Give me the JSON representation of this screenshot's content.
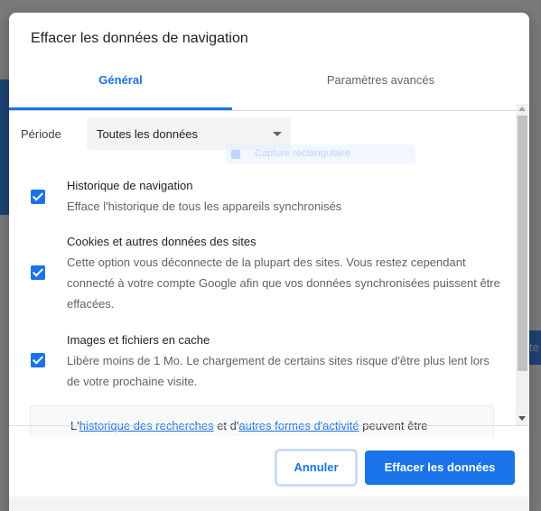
{
  "dialog": {
    "title": "Effacer les données de navigation"
  },
  "tabs": [
    {
      "label": "Général",
      "selected": true
    },
    {
      "label": "Paramètres avancés",
      "selected": false
    }
  ],
  "period": {
    "label": "Période",
    "value": "Toutes les données"
  },
  "background": {
    "tooltip_text": "Capture rectangulaire",
    "right_strip_text": "te"
  },
  "options": [
    {
      "title": "Historique de navigation",
      "description": "Efface l'historique de tous les appareils synchronisés",
      "checked": true
    },
    {
      "title": "Cookies et autres données des sites",
      "description": "Cette option vous déconnecte de la plupart des sites. Vous restez cependant connecté à votre compte Google afin que vos données synchronisées puissent être effacées.",
      "checked": true
    },
    {
      "title": "Images et fichiers en cache",
      "description": "Libère moins de 1 Mo. Le chargement de certains sites risque d'être plus lent lors de votre prochaine visite.",
      "checked": true
    }
  ],
  "notice": {
    "prefix": "L'",
    "link1": "historique des recherches",
    "middle": " et d'",
    "link2": "autres formes d'activité",
    "suffix": " peuvent être"
  },
  "footer": {
    "cancel_label": "Annuler",
    "clear_label": "Effacer les données"
  },
  "colors": {
    "accent": "#1a73e8",
    "scrim": "#5f6166"
  }
}
